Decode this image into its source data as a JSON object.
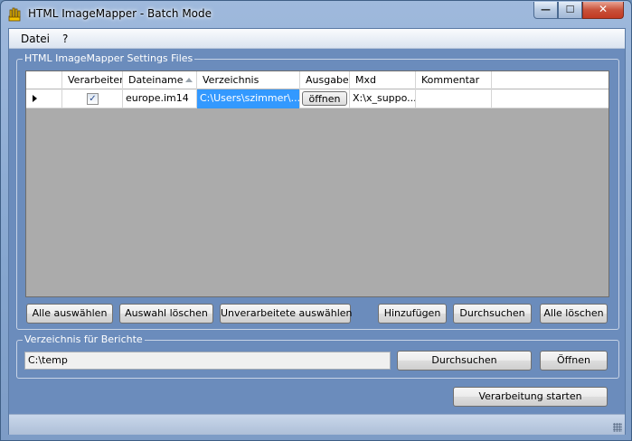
{
  "window": {
    "title": "HTML ImageMapper - Batch Mode"
  },
  "caption_buttons": {
    "minimize": "—",
    "maximize": "☐",
    "close": "✕"
  },
  "menu": [
    {
      "label": "Datei"
    },
    {
      "label": "?"
    }
  ],
  "settings_group": {
    "legend": "HTML ImageMapper Settings Files",
    "columns": [
      "Verarbeiten",
      "Dateiname",
      "Verzeichnis",
      "Ausgabe",
      "Mxd",
      "Kommentar"
    ],
    "sorted_column": "Dateiname",
    "rows": [
      {
        "verarbeiten": true,
        "dateiname": "europe.im14",
        "verzeichnis": "C:\\Users\\szimmer\\...",
        "ausgabe_button": "öffnen",
        "mxd": "X:\\x_suppo...",
        "kommentar": ""
      }
    ],
    "buttons": {
      "select_all": "Alle auswählen",
      "clear_selection": "Auswahl löschen",
      "select_unprocessed": "Unverarbeitete auswählen",
      "add": "Hinzufügen",
      "browse": "Durchsuchen",
      "delete_all": "Alle löschen"
    }
  },
  "report_group": {
    "legend": "Verzeichnis für Berichte",
    "path": "C:\\temp",
    "browse": "Durchsuchen",
    "open": "Öffnen"
  },
  "start_button": "Verarbeitung starten",
  "colors": {
    "selection": "#3399ff",
    "grid_bg": "#ababab",
    "client_bg": "#6b8cbc"
  }
}
